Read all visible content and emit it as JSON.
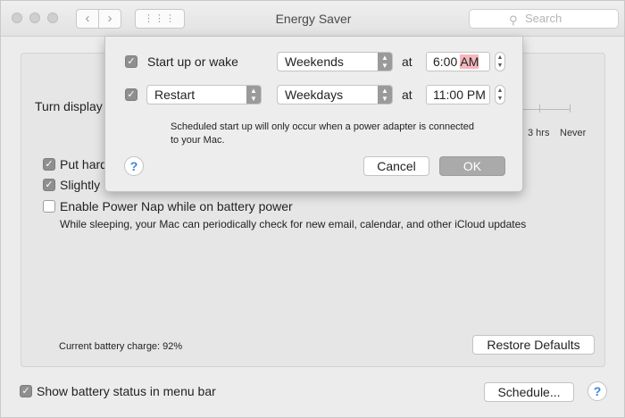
{
  "window": {
    "title": "Energy Saver",
    "search_placeholder": "Search",
    "nav_back": "‹",
    "nav_forward": "›",
    "grid": "⋮⋮⋮"
  },
  "panel": {
    "turn_display_label": "Turn display",
    "slider_labels": [
      "3 hrs",
      "Never"
    ],
    "options": [
      {
        "label": "Put hard",
        "checked": true
      },
      {
        "label": "Slightly",
        "checked": true
      },
      {
        "label": "Enable Power Nap while on battery power",
        "checked": false
      }
    ],
    "power_nap_sub": "While sleeping, your Mac can periodically check for new email, calendar, and other iCloud updates",
    "battery_charge": "Current battery charge: 92%",
    "restore_defaults": "Restore Defaults",
    "show_battery_status": "Show battery status in menu bar",
    "schedule_button": "Schedule...",
    "help": "?"
  },
  "sheet": {
    "row1": {
      "label": "Start up or wake",
      "checked": true,
      "days": "Weekends",
      "at": "at",
      "time_hm": "6:00",
      "time_ampm": "AM"
    },
    "row2": {
      "action": "Restart",
      "checked": true,
      "days": "Weekdays",
      "at": "at",
      "time_hm": "11:00",
      "time_ampm": "PM"
    },
    "note": "Scheduled start up will only occur when a power adapter is connected to your Mac.",
    "help": "?",
    "cancel": "Cancel",
    "ok": "OK"
  },
  "colors": {
    "highlight": "#f5b7bd",
    "help_blue": "#3d84d8"
  }
}
